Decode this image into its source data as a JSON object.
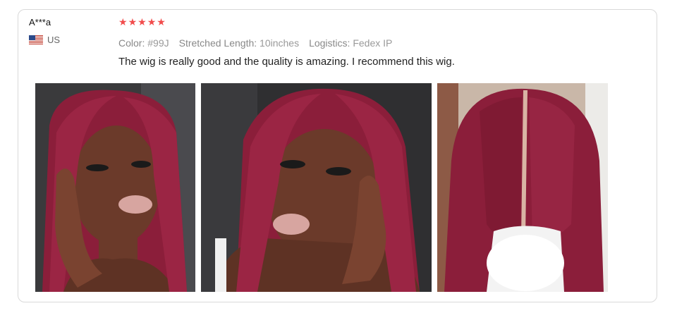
{
  "review": {
    "reviewer_name": "A***a",
    "country": "US",
    "flag_icon": "us-flag-icon",
    "rating": 5,
    "attributes": [
      {
        "key": "Color:",
        "value": "#99J"
      },
      {
        "key": "Stretched Length:",
        "value": "10inches"
      },
      {
        "key": "Logistics:",
        "value": "Fedex IP"
      }
    ],
    "text": "The wig is really good and the quality is amazing. I recommend this wig."
  },
  "colors": {
    "star": "#f14c4c",
    "border": "#d9d9d9",
    "hair": "#8e1f3a"
  }
}
